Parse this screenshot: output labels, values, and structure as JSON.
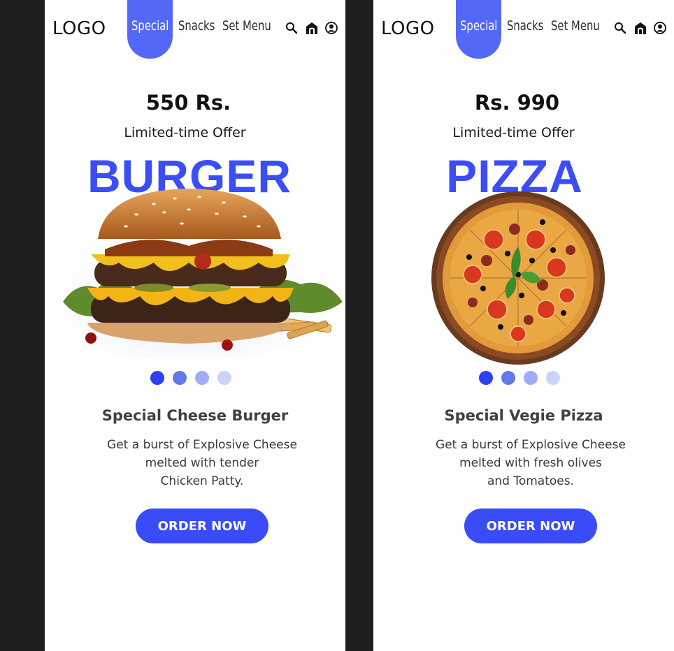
{
  "colors": {
    "accent": "#3b4ef5",
    "nav_pill": "#5468f7",
    "background": "#1f1f1f"
  },
  "screens": [
    {
      "logo": "LOGO",
      "nav": {
        "special": "Special",
        "snacks": "Snacks",
        "set_menu": "Set Menu"
      },
      "icons": [
        "search-icon",
        "home-icon",
        "user-icon"
      ],
      "price": "550 Rs.",
      "offer": "Limited-time Offer",
      "title": "BURGER",
      "item_title": "Special Cheese Burger",
      "description": [
        "Get a burst of Explosive Cheese",
        "melted with tender",
        "Chicken Patty."
      ],
      "cta": "ORDER NOW",
      "carousel": {
        "count": 4,
        "active": 1
      }
    },
    {
      "logo": "LOGO",
      "nav": {
        "special": "Special",
        "snacks": "Snacks",
        "set_menu": "Set Menu"
      },
      "icons": [
        "search-icon",
        "home-icon",
        "user-icon"
      ],
      "price": "Rs. 990",
      "offer": "Limited-time Offer",
      "title": "PIZZA",
      "item_title": "Special Vegie Pizza",
      "description": [
        "Get a burst of Explosive Cheese",
        "melted with fresh olives",
        "and Tomatoes."
      ],
      "cta": "ORDER NOW",
      "carousel": {
        "count": 4,
        "active": 1
      }
    }
  ]
}
